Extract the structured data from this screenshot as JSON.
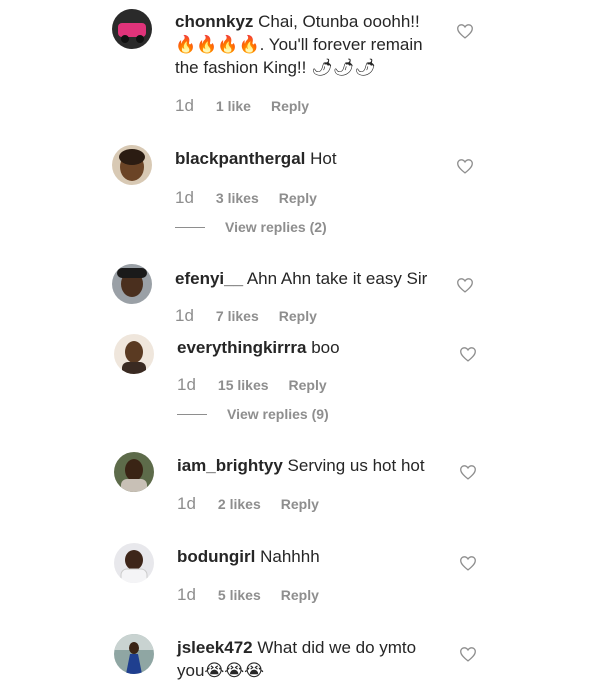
{
  "comments": [
    {
      "username": "chonnkyz",
      "text_before": "Chai, Otunba ooohh!!",
      "emojis_fire": "🔥🔥🔥🔥",
      "text_after": ". You'll forever remain the fashion King!! 🌶🌶🌶",
      "time": "1d",
      "likes": "1 like",
      "reply": "Reply"
    },
    {
      "username": "blackpanthergal",
      "text": "Hot",
      "time": "1d",
      "likes": "3 likes",
      "reply": "Reply",
      "view_replies": "View replies (2)"
    },
    {
      "username": "efenyi__",
      "text": "Ahn Ahn take it easy Sir",
      "time": "1d",
      "likes": "7 likes",
      "reply": "Reply"
    },
    {
      "username": "everythingkirrra",
      "text": "boo",
      "time": "1d",
      "likes": "15 likes",
      "reply": "Reply",
      "view_replies": "View replies (9)"
    },
    {
      "username": "iam_brightyy",
      "text": "Serving us hot hot",
      "time": "1d",
      "likes": "2 likes",
      "reply": "Reply"
    },
    {
      "username": "bodungirl",
      "text": "Nahhhh",
      "time": "1d",
      "likes": "5 likes",
      "reply": "Reply"
    },
    {
      "username": "jsleek472",
      "text": "What did we do ymto you",
      "emojis_cry": "😭😭😭"
    }
  ],
  "icons": {
    "heart": "heart-outline-icon",
    "avatar": "avatar"
  },
  "colors": {
    "text": "#262626",
    "secondary": "#8e8e8e"
  }
}
